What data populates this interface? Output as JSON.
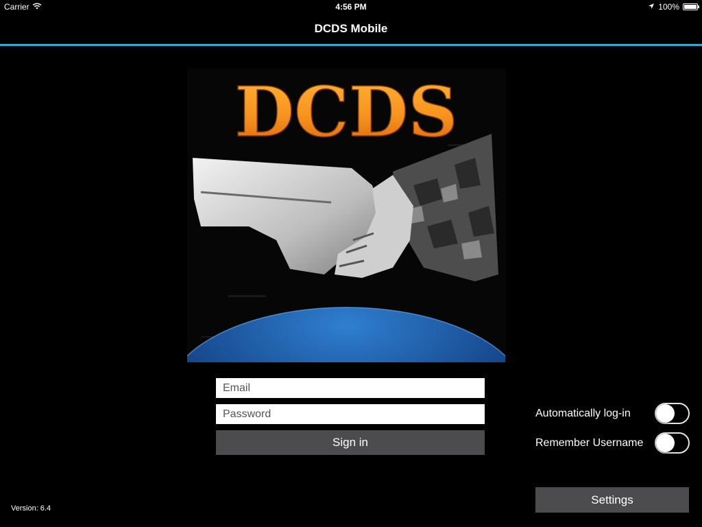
{
  "status_bar": {
    "carrier": "Carrier",
    "time": "4:56 PM",
    "battery": "100%",
    "battery_level": 1.0
  },
  "nav": {
    "title": "DCDS Mobile"
  },
  "logo": {
    "text": "DCDS"
  },
  "form": {
    "email_placeholder": "Email",
    "password_placeholder": "Password",
    "signin_label": "Sign in"
  },
  "options": {
    "auto_login_label": "Automatically log-in",
    "auto_login_on": false,
    "remember_label": "Remember Username",
    "remember_on": false
  },
  "settings_label": "Settings",
  "version": "Version: 6.4",
  "colors": {
    "accent": "#3aa7cf",
    "button": "#4c4c4e",
    "logo_orange": "#f7931e",
    "globe_blue": "#1f5fa8"
  }
}
